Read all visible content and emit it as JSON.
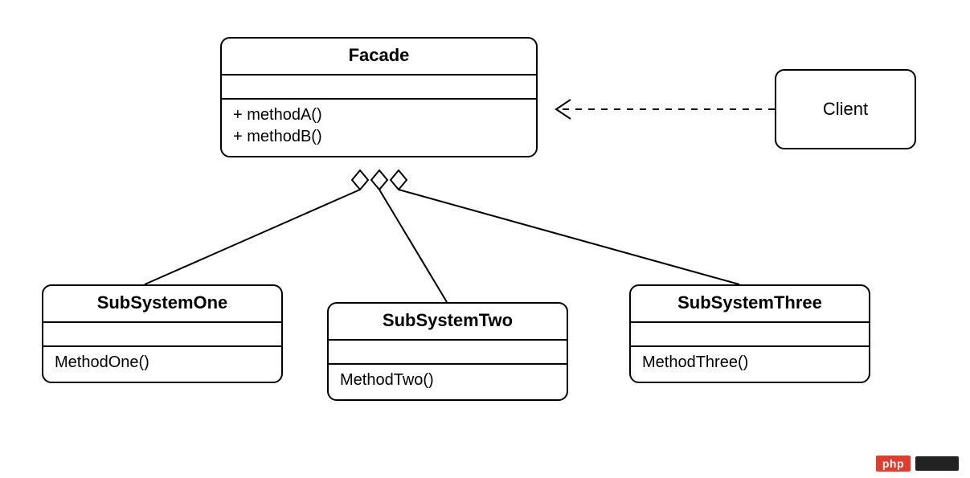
{
  "facade": {
    "name": "Facade",
    "methods": [
      "+ methodA()",
      "+ methodB()"
    ]
  },
  "client": {
    "name": "Client"
  },
  "subsystems": [
    {
      "name": "SubSystemOne",
      "method": "MethodOne()"
    },
    {
      "name": "SubSystemTwo",
      "method": "MethodTwo()"
    },
    {
      "name": "SubSystemThree",
      "method": "MethodThree()"
    }
  ],
  "watermark": {
    "badge": "php"
  },
  "relations": {
    "client_to_facade": "dependency",
    "facade_to_subsystems": "aggregation"
  }
}
